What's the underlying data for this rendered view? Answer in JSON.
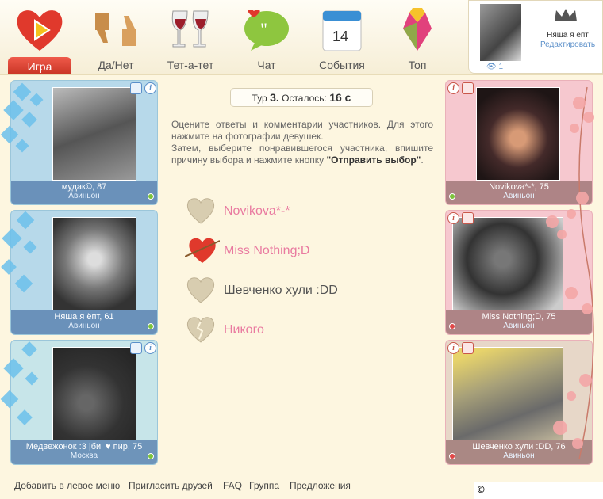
{
  "nav": [
    {
      "label": "Игра",
      "icon": "heart-play-icon",
      "active": true
    },
    {
      "label": "Да/Нет",
      "icon": "thumbs-icon"
    },
    {
      "label": "Тет-а-тет",
      "icon": "wine-glasses-icon"
    },
    {
      "label": "Чат",
      "icon": "chat-bubble-icon"
    },
    {
      "label": "События",
      "icon": "calendar-icon",
      "badge": "14"
    },
    {
      "label": "Топ",
      "icon": "gift-top-icon"
    }
  ],
  "profile": {
    "name": "Няша я ёпт",
    "edit_label": "Редактировать",
    "views": "1"
  },
  "round": {
    "prefix": "Тур",
    "number": "3.",
    "remaining_label": "Осталось:",
    "seconds": "16 с"
  },
  "instructions": {
    "line1": "Оцените ответы и комментарии участников. Для этого нажмите на фотографии девушек.",
    "line2_prefix": "Затем, выберите понравившегося участника, впишите причину выбора и нажмите кнопку ",
    "line2_bold": "\"Отправить выбор\"",
    "line2_suffix": "."
  },
  "choices": [
    {
      "label": "Novikova*-*",
      "style": "pink",
      "icon": "heart-icon"
    },
    {
      "label": "Miss Nothing;D",
      "style": "pink",
      "icon": "arrow-heart-icon"
    },
    {
      "label": "Шевченко хули :DD",
      "style": "gray",
      "icon": "heart-icon"
    },
    {
      "label": "Никого",
      "style": "pink",
      "icon": "broken-heart-icon"
    }
  ],
  "left_cards": [
    {
      "name": "мудак©, 87",
      "city": "Авиньон",
      "online": true
    },
    {
      "name": "Няша я ёпт, 61",
      "city": "Авиньон",
      "online": true
    },
    {
      "name": "Медвежонок :3 |би| ♥ пир, 75",
      "city": "Москва",
      "online": true
    }
  ],
  "right_cards": [
    {
      "name": "Novikova*-*, 75",
      "city": "Авиньон",
      "online": true
    },
    {
      "name": "Miss Nothing;D, 75",
      "city": "Авиньон",
      "online": false
    },
    {
      "name": "Шевченко хули :DD, 76",
      "city": "Авиньон",
      "online": false
    }
  ],
  "footer": [
    "Добавить в левое меню",
    "Пригласить друзей",
    "FAQ",
    "Группа",
    "Предложения"
  ],
  "copyright": "© love.vkontakte.ru",
  "colors": {
    "online": "#7cc33c",
    "offline": "#e04848",
    "accent": "#e14a3a",
    "link": "#5b8fc9",
    "pink_text": "#e97aa0"
  }
}
